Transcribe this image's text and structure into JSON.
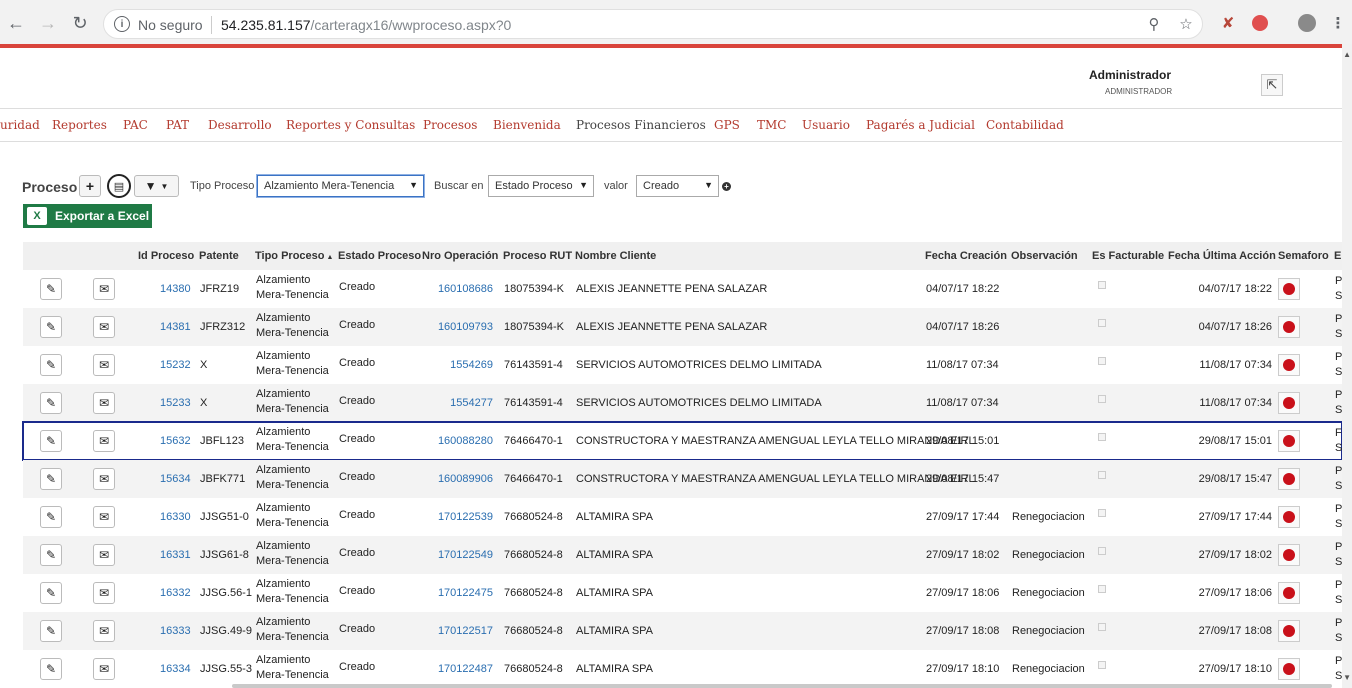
{
  "browser": {
    "security_text": "No seguro",
    "url_host": "54.235.81.157",
    "url_path": "/carteragx16/wwproceso.aspx?0"
  },
  "header": {
    "user_name": "Administrador",
    "user_role": "ADMINISTRADOR"
  },
  "menu": [
    "uridad",
    "Reportes",
    "PAC",
    "PAT",
    "Desarrollo",
    "Reportes y Consultas",
    "Procesos",
    "Bienvenida",
    "Procesos Financieros",
    "GPS",
    "TMC",
    "Usuario",
    "Pagarés a Judicial",
    "Contabilidad"
  ],
  "toolbar": {
    "title": "Proceso",
    "tipo_label": "Tipo Proceso",
    "tipo_value": "Alzamiento Mera-Tenencia",
    "buscar_label": "Buscar en",
    "buscar_value": "Estado Proceso",
    "valor_label": "valor",
    "valor_value": "Creado",
    "export_label": "Exportar a Excel",
    "excel_icon": "X"
  },
  "columns": {
    "id": "Id Proceso",
    "patente": "Patente",
    "tipo": "Tipo Proceso",
    "sort_marker": "▲",
    "estado": "Estado Proceso",
    "nro_op": "Nro Operación",
    "rut": "Proceso RUT",
    "cliente": "Nombre Cliente",
    "fecha_creacion": "Fecha Creación",
    "observacion": "Observación",
    "facturable": "Es Facturable",
    "fecha_ultima": "Fecha Última Acción",
    "semaforo": "Semaforo",
    "extra": "Er"
  },
  "rows": [
    {
      "id": "14380",
      "patente": "JFRZ19",
      "tipo1": "Alzamiento",
      "tipo2": "Mera-Tenencia",
      "estado": "Creado",
      "nro": "160108686",
      "rut": "18075394-K",
      "cliente": "ALEXIS JEANNETTE PENA SALAZAR",
      "fc": "04/07/17 18:22",
      "obs": "",
      "fu": "04/07/17 18:22",
      "e1": "Pr",
      "e2": "S."
    },
    {
      "id": "14381",
      "patente": "JFRZ312",
      "tipo1": "Alzamiento",
      "tipo2": "Mera-Tenencia",
      "estado": "Creado",
      "nro": "160109793",
      "rut": "18075394-K",
      "cliente": "ALEXIS JEANNETTE PENA SALAZAR",
      "fc": "04/07/17 18:26",
      "obs": "",
      "fu": "04/07/17 18:26",
      "e1": "Pr",
      "e2": "S."
    },
    {
      "id": "15232",
      "patente": "X",
      "tipo1": "Alzamiento",
      "tipo2": "Mera-Tenencia",
      "estado": "Creado",
      "nro": "1554269",
      "rut": "76143591-4",
      "cliente": "SERVICIOS AUTOMOTRICES DELMO LIMITADA",
      "fc": "11/08/17 07:34",
      "obs": "",
      "fu": "11/08/17 07:34",
      "e1": "Pr",
      "e2": "S."
    },
    {
      "id": "15233",
      "patente": "X",
      "tipo1": "Alzamiento",
      "tipo2": "Mera-Tenencia",
      "estado": "Creado",
      "nro": "1554277",
      "rut": "76143591-4",
      "cliente": "SERVICIOS AUTOMOTRICES DELMO LIMITADA",
      "fc": "11/08/17 07:34",
      "obs": "",
      "fu": "11/08/17 07:34",
      "e1": "Pr",
      "e2": "S."
    },
    {
      "id": "15632",
      "patente": "JBFL123",
      "tipo1": "Alzamiento",
      "tipo2": "Mera-Tenencia",
      "estado": "Creado",
      "nro": "160088280",
      "rut": "76466470-1",
      "cliente": "CONSTRUCTORA Y MAESTRANZA AMENGUAL LEYLA TELLO MIRANDA EIRL",
      "fc": "29/08/17 15:01",
      "obs": "",
      "fu": "29/08/17 15:01",
      "e1": "F",
      "e2": "S"
    },
    {
      "id": "15634",
      "patente": "JBFK771",
      "tipo1": "Alzamiento",
      "tipo2": "Mera-Tenencia",
      "estado": "Creado",
      "nro": "160089906",
      "rut": "76466470-1",
      "cliente": "CONSTRUCTORA Y MAESTRANZA AMENGUAL LEYLA TELLO MIRANDA EIRL",
      "fc": "29/08/17 15:47",
      "obs": "",
      "fu": "29/08/17 15:47",
      "e1": "Pr",
      "e2": "S."
    },
    {
      "id": "16330",
      "patente": "JJSG51-0",
      "tipo1": "Alzamiento",
      "tipo2": "Mera-Tenencia",
      "estado": "Creado",
      "nro": "170122539",
      "rut": "76680524-8",
      "cliente": "ALTAMIRA SPA",
      "fc": "27/09/17 17:44",
      "obs": "Renegociacion",
      "fu": "27/09/17 17:44",
      "e1": "Pr",
      "e2": "S."
    },
    {
      "id": "16331",
      "patente": "JJSG61-8",
      "tipo1": "Alzamiento",
      "tipo2": "Mera-Tenencia",
      "estado": "Creado",
      "nro": "170122549",
      "rut": "76680524-8",
      "cliente": "ALTAMIRA SPA",
      "fc": "27/09/17 18:02",
      "obs": "Renegociacion",
      "fu": "27/09/17 18:02",
      "e1": "Pr",
      "e2": "S."
    },
    {
      "id": "16332",
      "patente": "JJSG.56-1",
      "tipo1": "Alzamiento",
      "tipo2": "Mera-Tenencia",
      "estado": "Creado",
      "nro": "170122475",
      "rut": "76680524-8",
      "cliente": "ALTAMIRA SPA",
      "fc": "27/09/17 18:06",
      "obs": "Renegociacion",
      "fu": "27/09/17 18:06",
      "e1": "Pr",
      "e2": "S."
    },
    {
      "id": "16333",
      "patente": "JJSG.49-9",
      "tipo1": "Alzamiento",
      "tipo2": "Mera-Tenencia",
      "estado": "Creado",
      "nro": "170122517",
      "rut": "76680524-8",
      "cliente": "ALTAMIRA SPA",
      "fc": "27/09/17 18:08",
      "obs": "Renegociacion",
      "fu": "27/09/17 18:08",
      "e1": "Pr",
      "e2": "S."
    },
    {
      "id": "16334",
      "patente": "JJSG.55-3",
      "tipo1": "Alzamiento",
      "tipo2": "Mera-Tenencia",
      "estado": "Creado",
      "nro": "170122487",
      "rut": "76680524-8",
      "cliente": "ALTAMIRA SPA",
      "fc": "27/09/17 18:10",
      "obs": "Renegociacion",
      "fu": "27/09/17 18:10",
      "e1": "Pr",
      "e2": "S."
    }
  ],
  "icons": {
    "edit": "pencil-icon",
    "mail": "mail-icon",
    "semaforo": "red-light-icon"
  },
  "colors": {
    "menu_link": "#b33a2e",
    "link": "#2a6eb0",
    "excel_green": "#1f7a45",
    "semaforo_red": "#c9101a",
    "selected_row_border": "#1a2a8c"
  }
}
